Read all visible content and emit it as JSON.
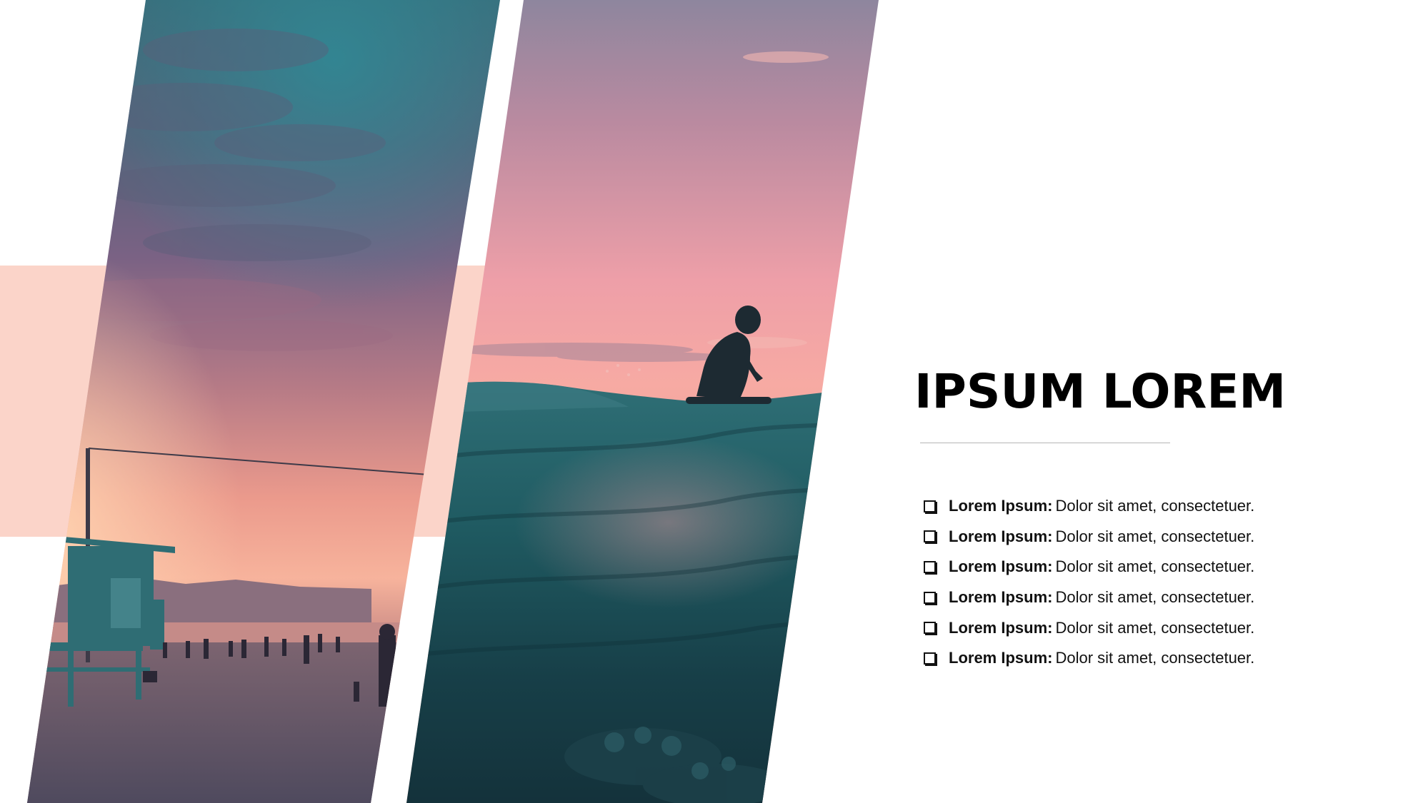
{
  "slide": {
    "title": "IPSUM LOREM",
    "accent_color": "#fbd4c9",
    "bullets": [
      {
        "label": "Lorem Ipsum:",
        "text": "Dolor sit amet, consectetuer.",
        "icon": "checkbox-icon"
      },
      {
        "label": "Lorem Ipsum:",
        "text": "Dolor sit amet, consectetuer.",
        "icon": "checkbox-icon"
      },
      {
        "label": "Lorem Ipsum:",
        "text": "Dolor sit amet, consectetuer.",
        "icon": "checkbox-icon"
      },
      {
        "label": "Lorem Ipsum:",
        "text": "Dolor sit amet, consectetuer.",
        "icon": "checkbox-icon"
      },
      {
        "label": "Lorem Ipsum:",
        "text": "Dolor sit amet, consectetuer.",
        "icon": "checkbox-icon"
      },
      {
        "label": "Lorem Ipsum:",
        "text": "Dolor sit amet, consectetuer.",
        "icon": "checkbox-icon"
      }
    ],
    "photos": [
      {
        "subject": "beach-lifeguard-tower-sunset"
      },
      {
        "subject": "surfer-on-wave-sunset"
      }
    ]
  }
}
